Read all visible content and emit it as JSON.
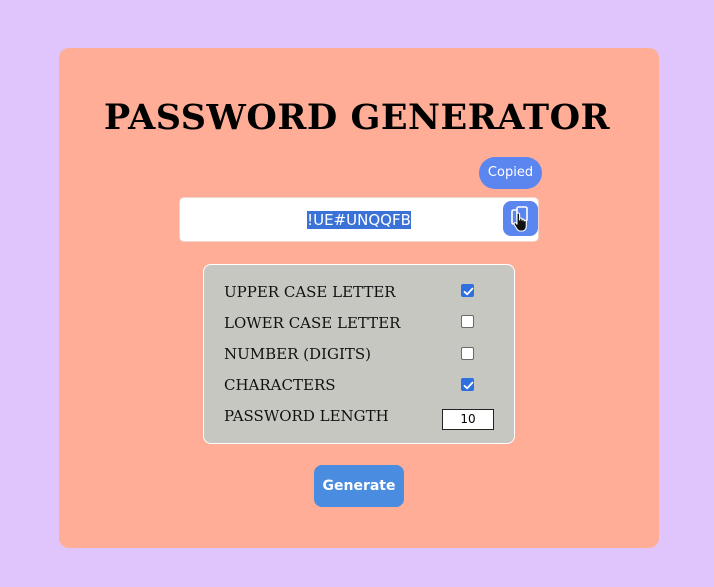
{
  "app": {
    "title": "PASSWORD GENERATOR"
  },
  "password": {
    "value": "!UE#UNQQFB",
    "copy_icon": "copy-icon",
    "cursor_icon": "hand-pointer-icon",
    "tooltip": "Copied"
  },
  "options": {
    "upper": {
      "label": "UPPER CASE LETTER",
      "checked": true
    },
    "lower": {
      "label": "LOWER CASE LETTER",
      "checked": false
    },
    "number": {
      "label": "NUMBER (DIGITS)",
      "checked": false
    },
    "characters": {
      "label": "CHARACTERS",
      "checked": true
    },
    "length": {
      "label": "PASSWORD LENGTH",
      "value": "10"
    }
  },
  "generate_button": {
    "label": "Generate"
  },
  "colors": {
    "background": "#dfc5fc",
    "card": "#ffad96",
    "accent": "#5b86f0",
    "generate": "#4a8ce0",
    "options_panel": "#c7c7c2"
  }
}
